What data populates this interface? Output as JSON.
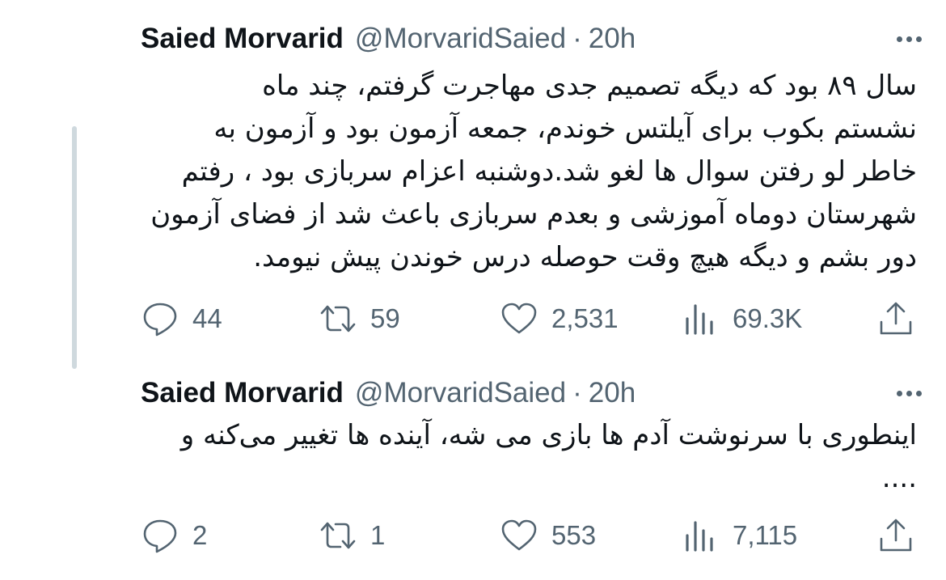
{
  "tweets": [
    {
      "author": {
        "name": "Saied Morvarid",
        "handle": "@MorvaridSaied",
        "separator": "·",
        "time": "20h"
      },
      "text": "سال ۸۹ بود که دیگه تصمیم جدی مهاجرت گرفتم، چند ماه\nنشستم بکوب برای آیلتس خوندم، جمعه آزمون بود و آزمون به\nخاطر لو رفتن سوال ها لغو شد.دوشنبه اعزام سربازی بود ، رفتم\nشهرستان دوماه آموزشی و بعدم سربازی باعث شد از فضای آزمون\nدور بشم و دیگه هیچ وقت حوصله درس خوندن پیش نیومد.",
      "stats": {
        "replies": "44",
        "retweets": "59",
        "likes": "2,531",
        "views": "69.3K"
      }
    },
    {
      "author": {
        "name": "Saied Morvarid",
        "handle": "@MorvaridSaied",
        "separator": "·",
        "time": "20h"
      },
      "text": "اینطوری با سرنوشت آدم ها بازی می شه، آینده ها تغییر می‌کنه و\n....",
      "stats": {
        "replies": "2",
        "retweets": "1",
        "likes": "553",
        "views": "7,115"
      }
    }
  ],
  "icons": {
    "reply": "reply-icon",
    "retweet": "retweet-icon",
    "like": "heart-icon",
    "views": "views-bar-chart-icon",
    "share": "share-icon",
    "more": "more-dots-icon"
  },
  "colors": {
    "text": "#0f1419",
    "secondary": "#536471",
    "thread_line": "#cfd9de",
    "background": "#ffffff"
  }
}
